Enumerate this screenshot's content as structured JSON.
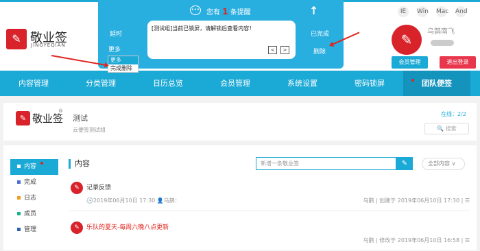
{
  "brand": {
    "cn": "敬业签",
    "en": "JINGYEQIAN",
    "glyph": "✎"
  },
  "popup": {
    "title_pre": "您有",
    "count": "1",
    "title_post": "条提醒",
    "delay": "延时",
    "message": "[测试组]当前已锁屏，请解锁后查看内容！",
    "prev": "<",
    "next": ">",
    "done": "已完成",
    "delete": "删除",
    "more": "更多"
  },
  "dropdown": [
    "更多",
    "完成删除"
  ],
  "user": {
    "name": "乌鹊南飞",
    "member_btn": "会员管理",
    "logout_btn": "退出登录"
  },
  "nav": [
    "内容管理",
    "分类管理",
    "日历总览",
    "会员管理",
    "系统设置",
    "密码锁屏",
    "团队便签"
  ],
  "team": {
    "name": "测试",
    "desc": "云便签测试组",
    "reg": "®",
    "online": "在线：2/2",
    "search": "搜索"
  },
  "sidebar": [
    {
      "label": "内容",
      "color": "#1ba9d6"
    },
    {
      "label": "完成",
      "color": "#4a6fd1"
    },
    {
      "label": "日志",
      "color": "#f0a020"
    },
    {
      "label": "成员",
      "color": "#1bb38a"
    },
    {
      "label": "管理",
      "color": "#2c63b8"
    }
  ],
  "main": {
    "title": "内容",
    "new_placeholder": "新增一条敬业签",
    "filter": "全部内容 ∨",
    "edit_icon": "✎"
  },
  "entries": [
    {
      "title": "记录反馈",
      "meta": "🕒2019年06月10日 17:30  👤乌鹊：",
      "right": "乌鹊 | 创建于 2019年06月10日 17:30 | ☰"
    },
    {
      "title": "乐队的夏天-每周六晚八点更新",
      "meta": "",
      "right": "乌鹊 | 修改于 2019年06月10日 16:58 | ☰"
    }
  ],
  "sys_icons": [
    "IE",
    "Win",
    "Mac",
    "And"
  ]
}
